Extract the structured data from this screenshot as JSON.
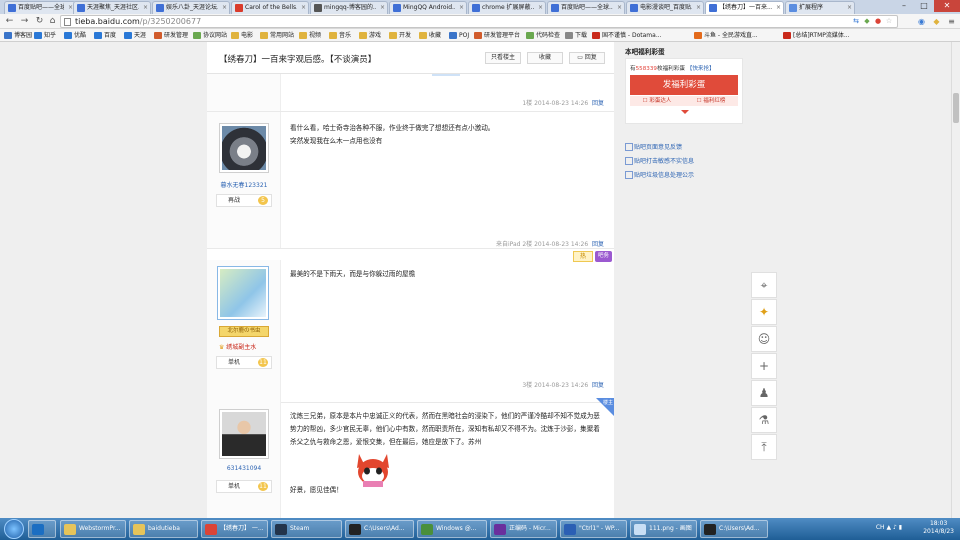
{
  "tabs": [
    {
      "label": "百度贴吧——全球最大...",
      "color": "#3f6fd6"
    },
    {
      "label": "天涯聚焦_天涯社区...",
      "color": "#3f6fd6"
    },
    {
      "label": "娱乐八卦_天涯论坛...",
      "color": "#3f6fd6"
    },
    {
      "label": "Carol of the Bells...",
      "color": "#d93b2b"
    },
    {
      "label": "mingqq-博客园的...",
      "color": "#555555"
    },
    {
      "label": "MingQQ Android...",
      "color": "#3f6fd6"
    },
    {
      "label": "chrome 扩展屏蔽...",
      "color": "#3f6fd6"
    },
    {
      "label": "百度贴吧——全球...",
      "color": "#3f6fd6"
    },
    {
      "label": "电影漫谈吧_百度贴...",
      "color": "#3f6fd6"
    },
    {
      "label": "【绣春刀】一百来...",
      "color": "#3f6fd6"
    },
    {
      "label": "扩展程序",
      "color": "#5a8de0"
    }
  ],
  "address": {
    "host": "tieba.baidu.com",
    "path": "/p/3250200677"
  },
  "bookmarks": [
    {
      "label": "博客园",
      "color": "#3a74c9"
    },
    {
      "label": "知乎",
      "color": "#2a78d6"
    },
    {
      "label": "优酷",
      "color": "#2a78d6"
    },
    {
      "label": "百度",
      "color": "#2a78d6"
    },
    {
      "label": "天涯",
      "color": "#2a78d6"
    },
    {
      "label": "研发管理",
      "color": "#d15b2b"
    },
    {
      "label": "协议网站",
      "color": "#6aa84f"
    },
    {
      "label": "电影",
      "color": "#e0b33e"
    },
    {
      "label": "常用网站",
      "color": "#e0b33e"
    },
    {
      "label": "视频",
      "color": "#e0b33e"
    },
    {
      "label": "音乐",
      "color": "#e0b33e"
    },
    {
      "label": "游戏",
      "color": "#e0b33e"
    },
    {
      "label": "开发",
      "color": "#e0b33e"
    },
    {
      "label": "收藏",
      "color": "#e0b33e"
    },
    {
      "label": "POJ",
      "color": "#3a74c9"
    },
    {
      "label": "研发管理平台",
      "color": "#d15b2b"
    },
    {
      "label": "代码检查",
      "color": "#6aa84f"
    },
    {
      "label": "下载",
      "color": "#888888"
    },
    {
      "label": "国不谨慎 - Dotama...",
      "color": "#c9291b"
    },
    {
      "label": "斗鱼 - 全民游戏直...",
      "color": "#e36a1b"
    },
    {
      "label": "[总结]RTMP流媒体...",
      "color": "#c9291b"
    }
  ],
  "thread": {
    "title": "【绣春刀】一百来字观后感。【不谈演员】",
    "buttons": [
      "只看楼主",
      "收藏",
      "回复"
    ]
  },
  "floors": [
    {
      "tail": "1楼 2014-08-23 14:26",
      "reply": "回复"
    },
    {
      "user": "暮水无春123321",
      "level_label": "再战",
      "level": "5",
      "text": [
        "看什么看，哈士奇寺治各种不服，作业终于做完了想想还有点小激动。",
        "突然发现我在么木一点用也没有"
      ],
      "tail": "来自iPad 2楼 2014-08-23 14:26",
      "reply": "回复"
    },
    {
      "user": "",
      "badge": "北尔鹿の书虫",
      "vip": "绣城副主水",
      "level_label": "单机",
      "level": "11",
      "text": [
        "最美的不是下雨天，而是与你躲过雨的屋檐"
      ],
      "tag": "热",
      "tag2": "吧务",
      "tail": "3楼 2014-08-23 14:26",
      "reply": "回复"
    },
    {
      "user": "631431094",
      "level_label": "单机",
      "level": "11",
      "corner": "楼主",
      "text": [
        "沈炼三兄弟，原本是本片中忠诚正义的代表，然而在黑暗社会的浸染下，他们的严谨冷酷却不知不觉成为恶势力的帮凶，多少官民无辜，他们心中有数，然而职责所在，深知有私却又不得不为。沈炼于沙彭，集聚着杀父之仇与救命之恩，爱恨交集，但在最后，她应是放下了。苏州",
        "好景，愿见佳偶！"
      ]
    }
  ],
  "sidebar": {
    "title": "本吧福利彩蛋",
    "have_prefix": "有",
    "have_amount": "558339",
    "have_suffix": "枚福利彩蛋",
    "join": "【快来抢】",
    "button": "发福利彩蛋",
    "sub": [
      "☐ 彩蛋达人",
      "☐ 福利红榜"
    ],
    "links": [
      "贴吧页面意见反馈",
      "贴吧打击敏感不实信息",
      "贴吧垃圾信息处理公示"
    ]
  },
  "taskbar": [
    {
      "label": "",
      "color": "#1b6ec2"
    },
    {
      "label": "WebstormPr...",
      "color": "#e6c45a"
    },
    {
      "label": "baidutieba",
      "color": "#e6c45a"
    },
    {
      "label": "【绣春刀】 一...",
      "color": "#db4437"
    },
    {
      "label": "Steam",
      "color": "#23344b"
    },
    {
      "label": "C:\\Users\\Ad...",
      "color": "#222222"
    },
    {
      "label": "Windows @...",
      "color": "#4a8f3a"
    },
    {
      "label": "正编码 - Micr...",
      "color": "#6a2f9d"
    },
    {
      "label": "\"Ctrl1\" - WP...",
      "color": "#2b5fb4"
    },
    {
      "label": "111.png - 画图",
      "color": "#c9dff5"
    },
    {
      "label": "C:\\Users\\Ad...",
      "color": "#222222"
    }
  ],
  "clock": {
    "time": "18:03",
    "date": "2014/8/23"
  },
  "tray": "CH"
}
